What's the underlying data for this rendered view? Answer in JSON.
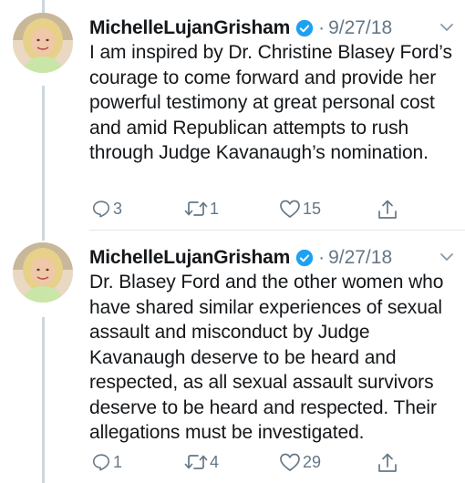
{
  "tweets": [
    {
      "author": "MichelleLujanGrisham",
      "date": "9/27/18",
      "text": "I am inspired by Dr. Christine Blasey Ford’s courage to come forward and provide her powerful testimony at great personal cost and amid Republican attempts to rush through Judge Kavanaugh’s nomination.",
      "replies": "3",
      "retweets": "1",
      "likes": "15"
    },
    {
      "author": "MichelleLujanGrisham",
      "date": "9/27/18",
      "text": "Dr. Blasey Ford and the other women who have shared similar experiences of sexual assault and misconduct by Judge Kavanaugh deserve to be heard and respected, as all sexual assault survivors deserve to be heard and respected. Their allegations must be investigated.",
      "replies": "1",
      "retweets": "4",
      "likes": "29"
    }
  ],
  "separator": "·",
  "colors": {
    "verified": "#1da1f2",
    "muted": "#657786",
    "thread_line": "#ccd6dd"
  }
}
